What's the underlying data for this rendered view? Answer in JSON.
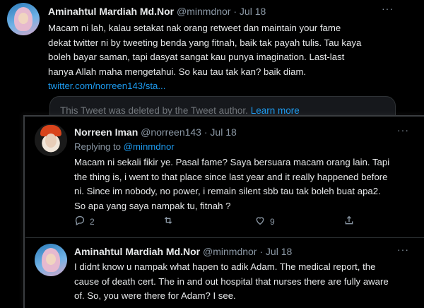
{
  "tweet1": {
    "name": "Aminahtul Mardiah Md.Nor",
    "handle": "@minmdnor",
    "date": "Jul 18",
    "text_lines": [
      "Macam ni lah, kalau setakat nak orang retweet dan maintain your fame",
      "dekat twitter ni by tweeting benda yang fitnah, baik tak payah tulis. Tau kaya",
      "boleh bayar saman, tapi dasyat sangat kau punya imagination. Last-last",
      "hanya Allah maha mengetahui. So kau tau tak kan? baik diam."
    ],
    "link": "twitter.com/norreen143/sta...",
    "deleted_notice": "This Tweet was deleted by the Tweet author.",
    "learn_more": "Learn more"
  },
  "tweet2": {
    "name": "Norreen Iman",
    "handle": "@norreen143",
    "date": "Jul 18",
    "replying_to_label": "Replying to",
    "replying_to_handle": "@minmdnor",
    "text_lines": [
      "Macam ni sekali fikir ye. Pasal fame? Saya bersuara macam orang lain. Tapi",
      "the thing is, i went to that place since last year and it really happened before",
      "ni. Since im nobody, no power, i remain silent sbb tau tak boleh buat apa2.",
      "So apa yang saya nampak tu, fitnah ?"
    ],
    "reply_count": "2",
    "retweet_count": "",
    "like_count": "9"
  },
  "tweet3": {
    "name": "Aminahtul Mardiah Md.Nor",
    "handle": "@minmdnor",
    "date": "Jul 18",
    "text_lines": [
      "I didnt know u nampak what hapen to adik Adam. The medical report, the",
      "cause of death cert. The in and out hospital that nurses there are fully aware",
      "of. So, you were there for Adam? I see."
    ]
  },
  "separator": "·",
  "more_glyph": "···",
  "colors": {
    "link": "#1d9bf0",
    "muted": "#8b98a5",
    "text": "#e7e9ea",
    "background": "#000000"
  },
  "icons": [
    "reply-icon",
    "retweet-icon",
    "like-icon",
    "share-icon",
    "more-icon"
  ]
}
